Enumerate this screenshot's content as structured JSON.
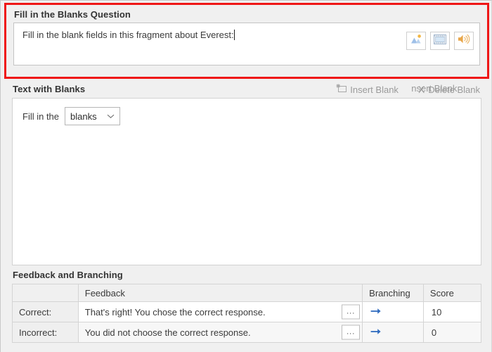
{
  "question_section": {
    "title": "Fill in the Blanks Question",
    "text_value": "Fill in the blank fields in this fragment about Everest:",
    "media_buttons": [
      {
        "name": "insert-picture-button",
        "icon": "picture-icon",
        "label": ""
      },
      {
        "name": "insert-video-button",
        "icon": "video-icon",
        "label": ""
      },
      {
        "name": "insert-audio-button",
        "icon": "audio-icon",
        "label": ""
      }
    ],
    "highlight_color": "#ef1717"
  },
  "blanks_section": {
    "title": "Text with Blanks",
    "insert_blank_label": "Insert Blank",
    "insert_blank_ghost_label": "nsert Blank",
    "delete_blank_label": "Delete Blank",
    "delete_icon": "X",
    "line_prefix": "Fill in the",
    "dropdown_value": "blanks",
    "dropdown_options": [
      "blanks"
    ]
  },
  "feedback_section": {
    "title": "Feedback and Branching",
    "columns": [
      "",
      "Feedback",
      "Branching",
      "Score"
    ],
    "rows": [
      {
        "label": "Correct:",
        "feedback": "That's right! You chose the correct response.",
        "more_label": "...",
        "branching": "→",
        "score": "10"
      },
      {
        "label": "Incorrect:",
        "feedback": "You did not choose the correct response.",
        "more_label": "...",
        "branching": "→",
        "score": "0"
      }
    ],
    "accent_color": "#2f6bbf"
  }
}
